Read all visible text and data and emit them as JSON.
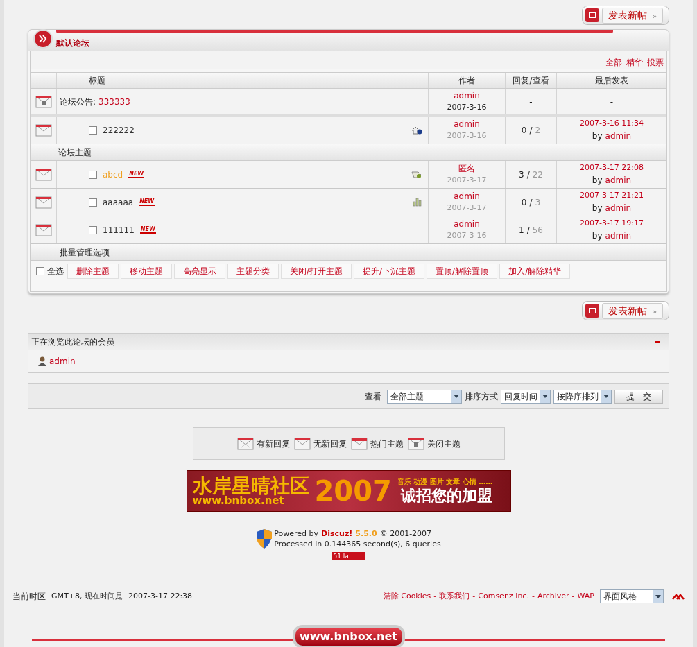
{
  "new_post_buttons": [
    {
      "label": "发表新帖",
      "caret": "»"
    },
    {
      "label": "发表新帖",
      "caret": "»"
    }
  ],
  "forum": {
    "title": "默认论坛",
    "filters": [
      "全部",
      "精华",
      "投票"
    ],
    "columns": [
      "标题",
      "作者",
      "回复/查看",
      "最后发表"
    ],
    "announcement": {
      "label": "论坛公告:",
      "title": "333333",
      "author": "admin",
      "date": "2007-3-16",
      "replies": "-",
      "last": "-"
    },
    "sticky": [
      {
        "kind": "stick",
        "title": "222222",
        "checked": false,
        "highlight": false,
        "author": "admin",
        "date": "2007-3-16",
        "replies": "0",
        "separator": "/",
        "views": "2",
        "last_time": "2007-3-16 11:34",
        "last_by_label": "by",
        "last_by": "admin"
      }
    ],
    "section_label": "论坛主题",
    "threads": [
      {
        "kind": "attachment",
        "title": "abcd",
        "checked": false,
        "highlight": true,
        "new_badge": "NEW",
        "author": "匿名",
        "date": "2007-3-17",
        "replies": "3",
        "separator": "/",
        "views": "22",
        "last_time": "2007-3-17 22:08",
        "last_by_label": "by",
        "last_by": "admin"
      },
      {
        "kind": "poll",
        "title": "aaaaaa",
        "checked": false,
        "highlight": false,
        "new_badge": "NEW",
        "author": "admin",
        "date": "2007-3-17",
        "replies": "0",
        "separator": "/",
        "views": "3",
        "last_time": "2007-3-17 21:21",
        "last_by_label": "by",
        "last_by": "admin"
      },
      {
        "kind": "plain",
        "title": "111111",
        "checked": false,
        "highlight": false,
        "new_badge": "NEW",
        "author": "admin",
        "date": "2007-3-16",
        "replies": "1",
        "separator": "/",
        "views": "56",
        "last_time": "2007-3-17 19:17",
        "last_by_label": "by",
        "last_by": "admin"
      }
    ],
    "batch_label": "批量管理选项",
    "select_all": {
      "label": "全选",
      "checked": false
    },
    "batch_buttons": [
      "删除主题",
      "移动主题",
      "高亮显示",
      "主题分类",
      "关闭/打开主题",
      "提升/下沉主题",
      "置顶/解除置顶",
      "加入/解除精华"
    ]
  },
  "online": {
    "title": "正在浏览此论坛的会员",
    "members": [
      "admin"
    ]
  },
  "filter_bar": {
    "view_label": "查看",
    "view": "全部主题",
    "sort_label": "排序方式",
    "sort": "回复时间",
    "order": "按降序排列",
    "submit": "提　交"
  },
  "legend": [
    {
      "kind": "new",
      "label": "有新回复"
    },
    {
      "kind": "normal",
      "label": "无新回复"
    },
    {
      "kind": "hot",
      "label": "热门主题"
    },
    {
      "kind": "closed",
      "label": "关闭主题"
    }
  ],
  "banner": {
    "title": "水岸星晴社区",
    "url": "www.bnbox.net",
    "year": "2007",
    "tagline": "音乐 动漫 图片 文章 心情 ……",
    "slogan": "诚招您的加盟"
  },
  "footer": {
    "powered": "Powered by",
    "brand": "Discuz!",
    "version": "5.5.0",
    "copyright": "© 2001-2007",
    "processed": "Processed in 0.144365 second(s), 6 queries",
    "counter": "51.la"
  },
  "bottom": {
    "timezone_label": "当前时区",
    "timezone": "GMT+8, 现在时间是",
    "time": "2007-3-17 22:38",
    "links": [
      {
        "label": "清除 Cookies"
      },
      {
        "separator": "-",
        "label": "联系我们"
      },
      {
        "separator": "-",
        "label": "Comsenz Inc."
      },
      {
        "separator": "-",
        "label": "Archiver"
      },
      {
        "separator": "-",
        "label": "WAP"
      }
    ],
    "style_select": "界面风格",
    "site_badge": "www.bnbox.net"
  }
}
